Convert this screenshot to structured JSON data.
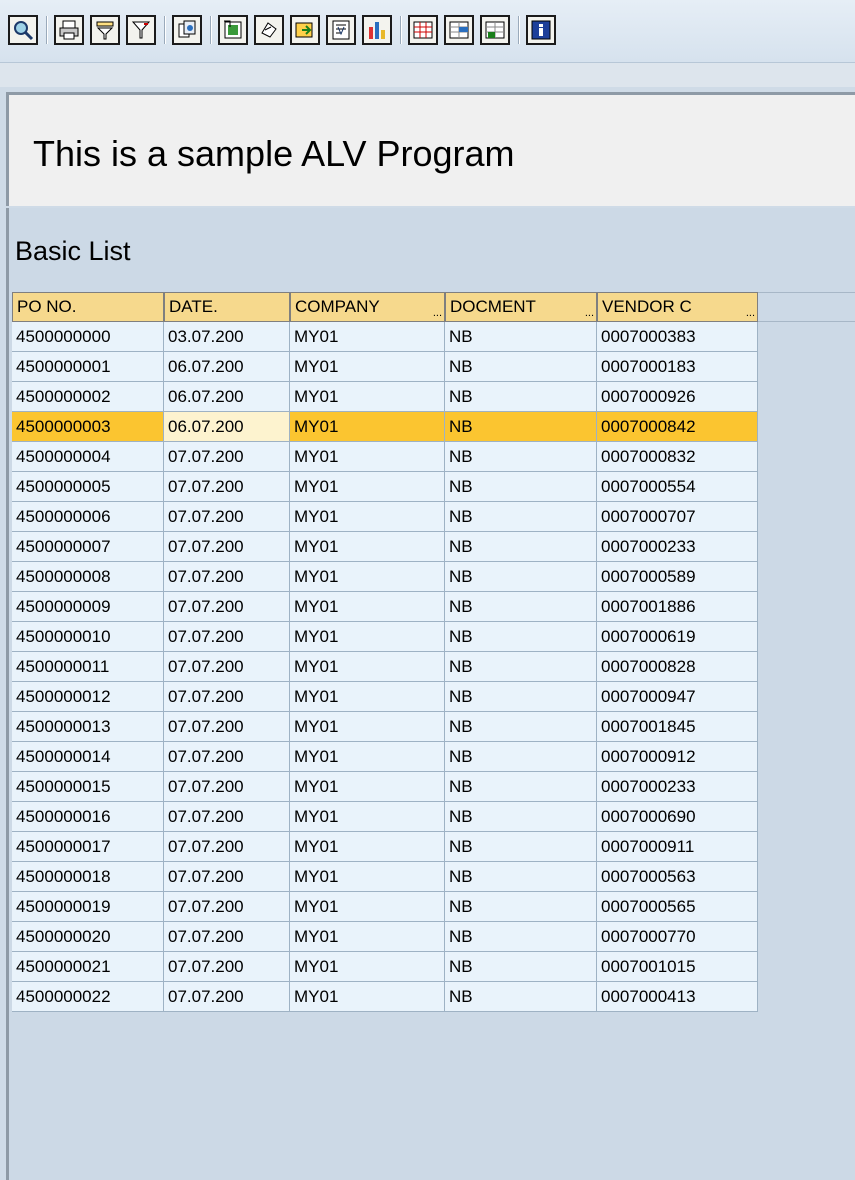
{
  "toolbar": {
    "buttons": [
      "details-icon",
      "print-icon",
      "filter-icon",
      "set-filter-icon",
      "sum-icon",
      "export-spreadsheet-icon",
      "sort-icon",
      "local-file-icon",
      "word-processing-icon",
      "graphic-icon",
      "change-layout-icon",
      "select-layout-icon",
      "save-layout-icon",
      "info-icon"
    ]
  },
  "title": "This is a sample ALV Program",
  "list_title": "Basic List",
  "columns": [
    "PO NO.",
    "DATE.",
    "COMPANY",
    "DOCMENT",
    "VENDOR C"
  ],
  "rows": [
    [
      "4500000000",
      "03.07.200",
      "MY01",
      "NB",
      "0007000383"
    ],
    [
      "4500000001",
      "06.07.200",
      "MY01",
      "NB",
      "0007000183"
    ],
    [
      "4500000002",
      "06.07.200",
      "MY01",
      "NB",
      "0007000926"
    ],
    [
      "4500000003",
      "06.07.200",
      "MY01",
      "NB",
      "0007000842"
    ],
    [
      "4500000004",
      "07.07.200",
      "MY01",
      "NB",
      "0007000832"
    ],
    [
      "4500000005",
      "07.07.200",
      "MY01",
      "NB",
      "0007000554"
    ],
    [
      "4500000006",
      "07.07.200",
      "MY01",
      "NB",
      "0007000707"
    ],
    [
      "4500000007",
      "07.07.200",
      "MY01",
      "NB",
      "0007000233"
    ],
    [
      "4500000008",
      "07.07.200",
      "MY01",
      "NB",
      "0007000589"
    ],
    [
      "4500000009",
      "07.07.200",
      "MY01",
      "NB",
      "0007001886"
    ],
    [
      "4500000010",
      "07.07.200",
      "MY01",
      "NB",
      "0007000619"
    ],
    [
      "4500000011",
      "07.07.200",
      "MY01",
      "NB",
      "0007000828"
    ],
    [
      "4500000012",
      "07.07.200",
      "MY01",
      "NB",
      "0007000947"
    ],
    [
      "4500000013",
      "07.07.200",
      "MY01",
      "NB",
      "0007001845"
    ],
    [
      "4500000014",
      "07.07.200",
      "MY01",
      "NB",
      "0007000912"
    ],
    [
      "4500000015",
      "07.07.200",
      "MY01",
      "NB",
      "0007000233"
    ],
    [
      "4500000016",
      "07.07.200",
      "MY01",
      "NB",
      "0007000690"
    ],
    [
      "4500000017",
      "07.07.200",
      "MY01",
      "NB",
      "0007000911"
    ],
    [
      "4500000018",
      "07.07.200",
      "MY01",
      "NB",
      "0007000563"
    ],
    [
      "4500000019",
      "07.07.200",
      "MY01",
      "NB",
      "0007000565"
    ],
    [
      "4500000020",
      "07.07.200",
      "MY01",
      "NB",
      "0007000770"
    ],
    [
      "4500000021",
      "07.07.200",
      "MY01",
      "NB",
      "0007001015"
    ],
    [
      "4500000022",
      "07.07.200",
      "MY01",
      "NB",
      "0007000413"
    ]
  ],
  "selected_row": 3,
  "colors": {
    "header": "#f6d98d",
    "cell": "#e9f3fb",
    "selected": "#fbc530",
    "background": "#cfdbe7"
  }
}
